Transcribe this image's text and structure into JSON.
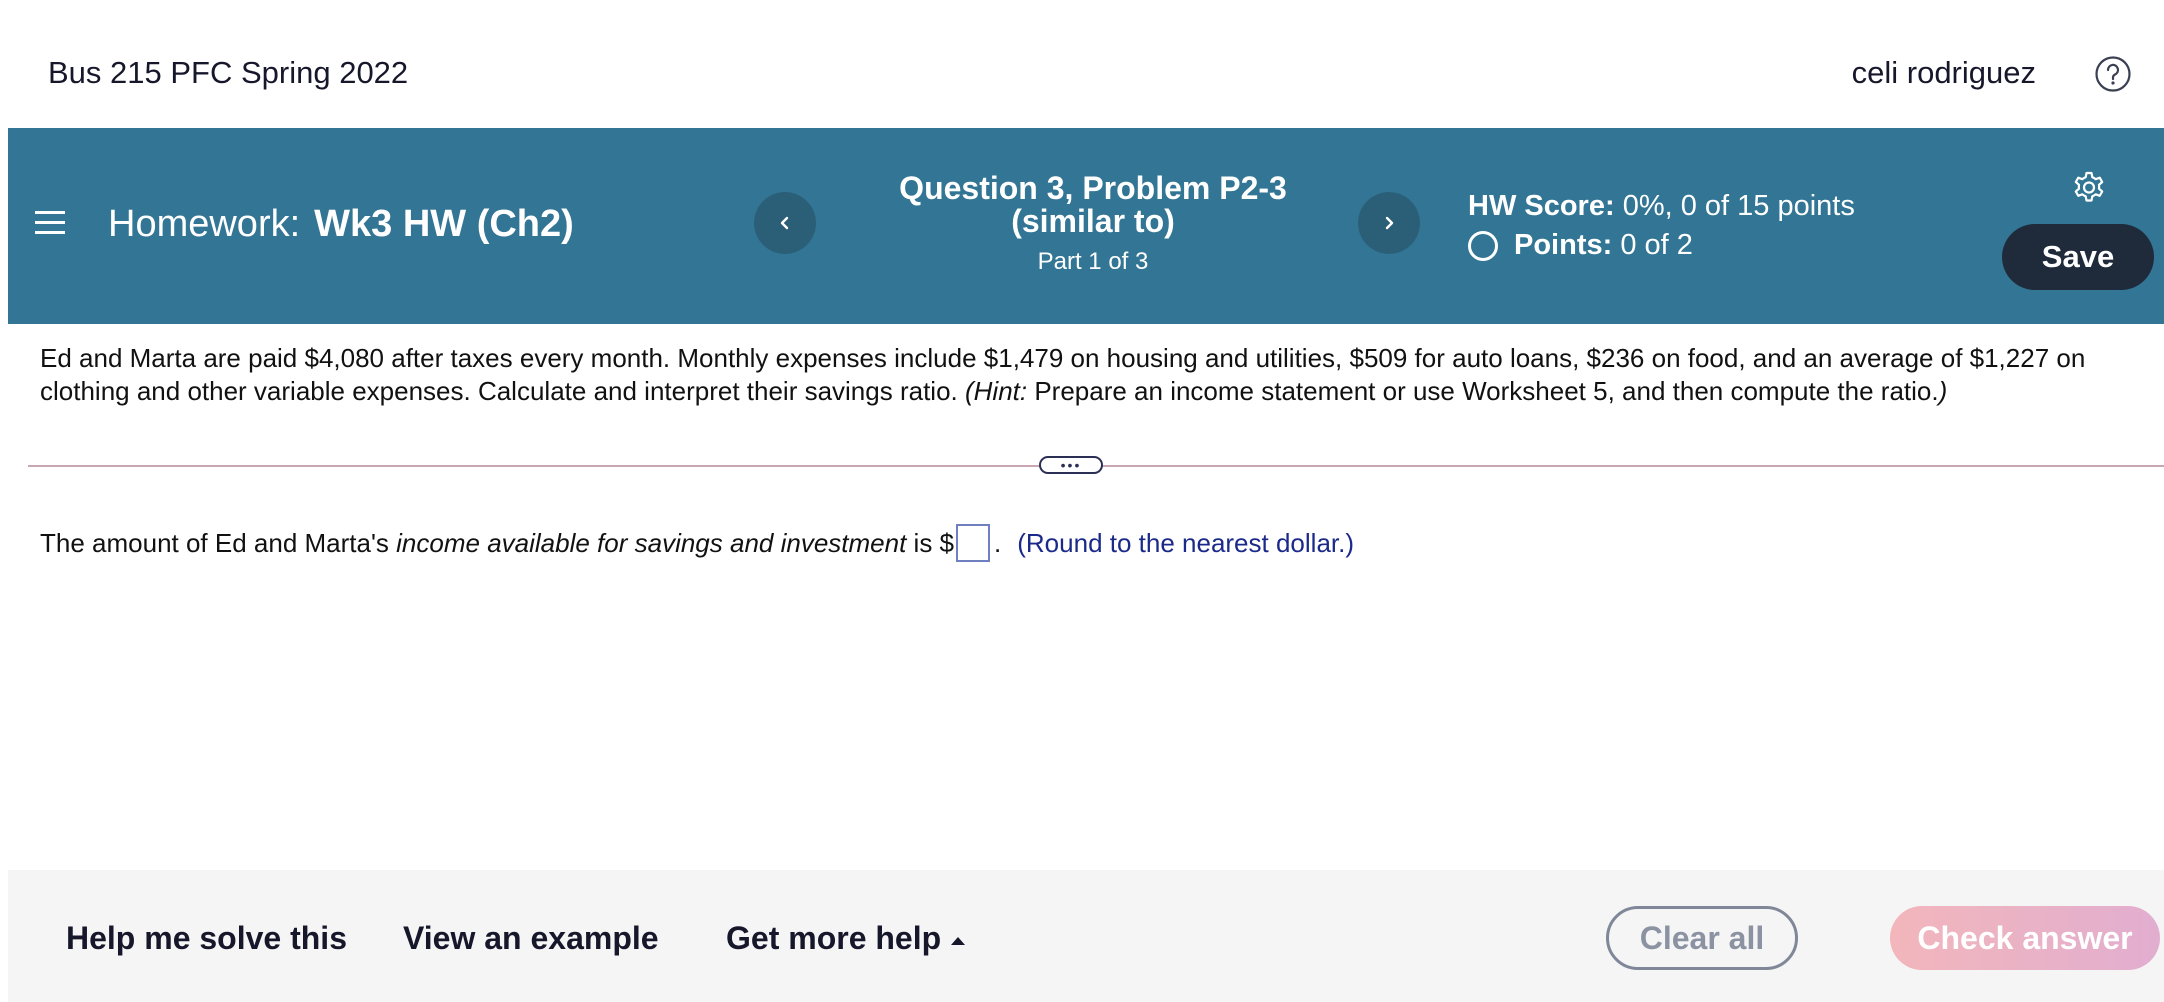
{
  "course": {
    "title": "Bus 215 PFC Spring 2022",
    "user_name": "celi rodriguez",
    "help_icon": "question-circle-icon"
  },
  "header": {
    "menu_icon": "hamburger-menu-icon",
    "homework_prefix": "Homework:",
    "homework_name": "Wk3 HW (Ch2)",
    "prev_icon": "chevron-left-icon",
    "next_icon": "chevron-right-icon",
    "question_title": "Question 3, Problem P2-3 (similar to)",
    "question_part": "Part 1 of 3",
    "score_label": "HW Score:",
    "score_value": "0%, 0 of 15 points",
    "points_label": "Points:",
    "points_value": "0 of 2",
    "settings_icon": "gear-icon",
    "save_label": "Save",
    "background_color": "#327594"
  },
  "question": {
    "text": "Ed and Marta are paid $4,080 after taxes every month. Monthly expenses include $1,479 on housing and utilities, $509 for auto loans, $236 on food, and an average of $1,227 on clothing and other variable expenses. Calculate and interpret their savings ratio. ",
    "hint_label": "(Hint:",
    "hint_text": " Prepare an income statement or use Worksheet 5, and then compute the ratio.",
    "hint_close": ")"
  },
  "answer": {
    "prefix": "The amount of Ed and Marta's ",
    "emphasis": "income available for savings and investment",
    "middle": " is $",
    "input_value": "",
    "suffix": ".",
    "round_note": "(Round to the nearest dollar.)"
  },
  "footer": {
    "help_solve": "Help me solve this",
    "view_example": "View an example",
    "more_help": "Get more help",
    "clear_all": "Clear all",
    "check_answer": "Check answer"
  }
}
